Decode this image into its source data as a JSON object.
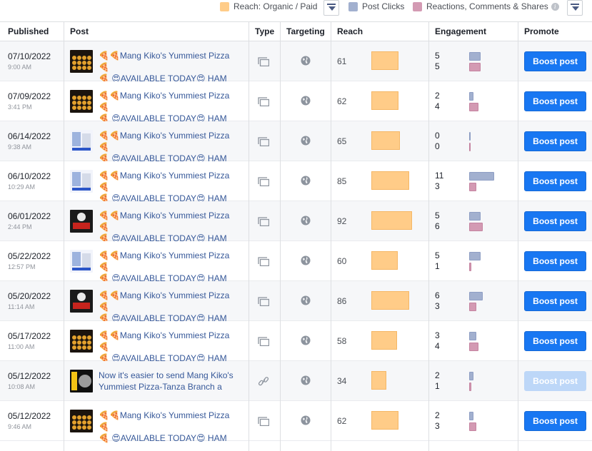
{
  "legend": {
    "reach": {
      "label": "Reach: Organic / Paid",
      "color": "#ffcc88"
    },
    "clicks": {
      "label": "Post Clicks",
      "color": "#a2b0cf"
    },
    "reactions": {
      "label": "Reactions, Comments & Shares",
      "color": "#d39ab3"
    },
    "info_icon": "i"
  },
  "columns": {
    "published": "Published",
    "post": "Post",
    "type": "Type",
    "targeting": "Targeting",
    "reach": "Reach",
    "engagement": "Engagement",
    "promote": "Promote"
  },
  "rows": [
    {
      "date": "07/10/2022",
      "time": "9:00 AM",
      "thumb": "pizza",
      "line1": "🍕🍕Mang Kiko's Yummiest Pizza 🍕",
      "line2": "🍕 😍AVAILABLE TODAY😍 HAM",
      "type_icon": "album-icon",
      "reach": 61,
      "clicks": 5,
      "reactions": 5,
      "boost": "Boost post",
      "boost_enabled": true
    },
    {
      "date": "07/09/2022",
      "time": "3:41 PM",
      "thumb": "pizza",
      "line1": "🍕🍕Mang Kiko's Yummiest Pizza 🍕",
      "line2": "🍕 😍AVAILABLE TODAY😍 HAM",
      "type_icon": "album-icon",
      "reach": 62,
      "clicks": 2,
      "reactions": 4,
      "boost": "Boost post",
      "boost_enabled": true
    },
    {
      "date": "06/14/2022",
      "time": "9:38 AM",
      "thumb": "promo",
      "line1": "🍕🍕Mang Kiko's Yummiest Pizza 🍕",
      "line2": "🍕 😍AVAILABLE TODAY😍 HAM",
      "type_icon": "album-icon",
      "reach": 65,
      "clicks": 0,
      "reactions": 0,
      "boost": "Boost post",
      "boost_enabled": true
    },
    {
      "date": "06/10/2022",
      "time": "10:29 AM",
      "thumb": "promo",
      "line1": "🍕🍕Mang Kiko's Yummiest Pizza 🍕",
      "line2": "🍕 😍AVAILABLE TODAY😍 HAM",
      "type_icon": "album-icon",
      "reach": 85,
      "clicks": 11,
      "reactions": 3,
      "boost": "Boost post",
      "boost_enabled": true
    },
    {
      "date": "06/01/2022",
      "time": "2:44 PM",
      "thumb": "dark",
      "line1": "🍕🍕Mang Kiko's Yummiest Pizza 🍕",
      "line2": "🍕 😍AVAILABLE TODAY😍 HAM",
      "type_icon": "album-icon",
      "reach": 92,
      "clicks": 5,
      "reactions": 6,
      "boost": "Boost post",
      "boost_enabled": true
    },
    {
      "date": "05/22/2022",
      "time": "12:57 PM",
      "thumb": "promo",
      "line1": "🍕🍕Mang Kiko's Yummiest Pizza 🍕",
      "line2": "🍕 😍AVAILABLE TODAY😍 HAM",
      "type_icon": "album-icon",
      "reach": 60,
      "clicks": 5,
      "reactions": 1,
      "boost": "Boost post",
      "boost_enabled": true
    },
    {
      "date": "05/20/2022",
      "time": "11:14 AM",
      "thumb": "dark",
      "line1": "🍕🍕Mang Kiko's Yummiest Pizza 🍕",
      "line2": "🍕 😍AVAILABLE TODAY😍 HAM",
      "type_icon": "album-icon",
      "reach": 86,
      "clicks": 6,
      "reactions": 3,
      "boost": "Boost post",
      "boost_enabled": true
    },
    {
      "date": "05/17/2022",
      "time": "11:00 AM",
      "thumb": "pizza",
      "line1": "🍕🍕Mang Kiko's Yummiest Pizza 🍕",
      "line2": "🍕 😍AVAILABLE TODAY😍 HAM",
      "type_icon": "album-icon",
      "reach": 58,
      "clicks": 3,
      "reactions": 4,
      "boost": "Boost post",
      "boost_enabled": true
    },
    {
      "date": "05/12/2022",
      "time": "10:08 AM",
      "thumb": "link",
      "line1": "Now it's easier to send Mang Kiko's",
      "line2": "Yummiest Pizza-Tanza Branch a",
      "type_icon": "link-icon",
      "reach": 34,
      "clicks": 2,
      "reactions": 1,
      "boost": "Boost post",
      "boost_enabled": false
    },
    {
      "date": "05/12/2022",
      "time": "9:46 AM",
      "thumb": "pizza",
      "line1": "🍕🍕Mang Kiko's Yummiest Pizza 🍕",
      "line2": "🍕 😍AVAILABLE TODAY😍 HAM",
      "type_icon": "album-icon",
      "reach": 62,
      "clicks": 2,
      "reactions": 3,
      "boost": "Boost post",
      "boost_enabled": true
    }
  ]
}
